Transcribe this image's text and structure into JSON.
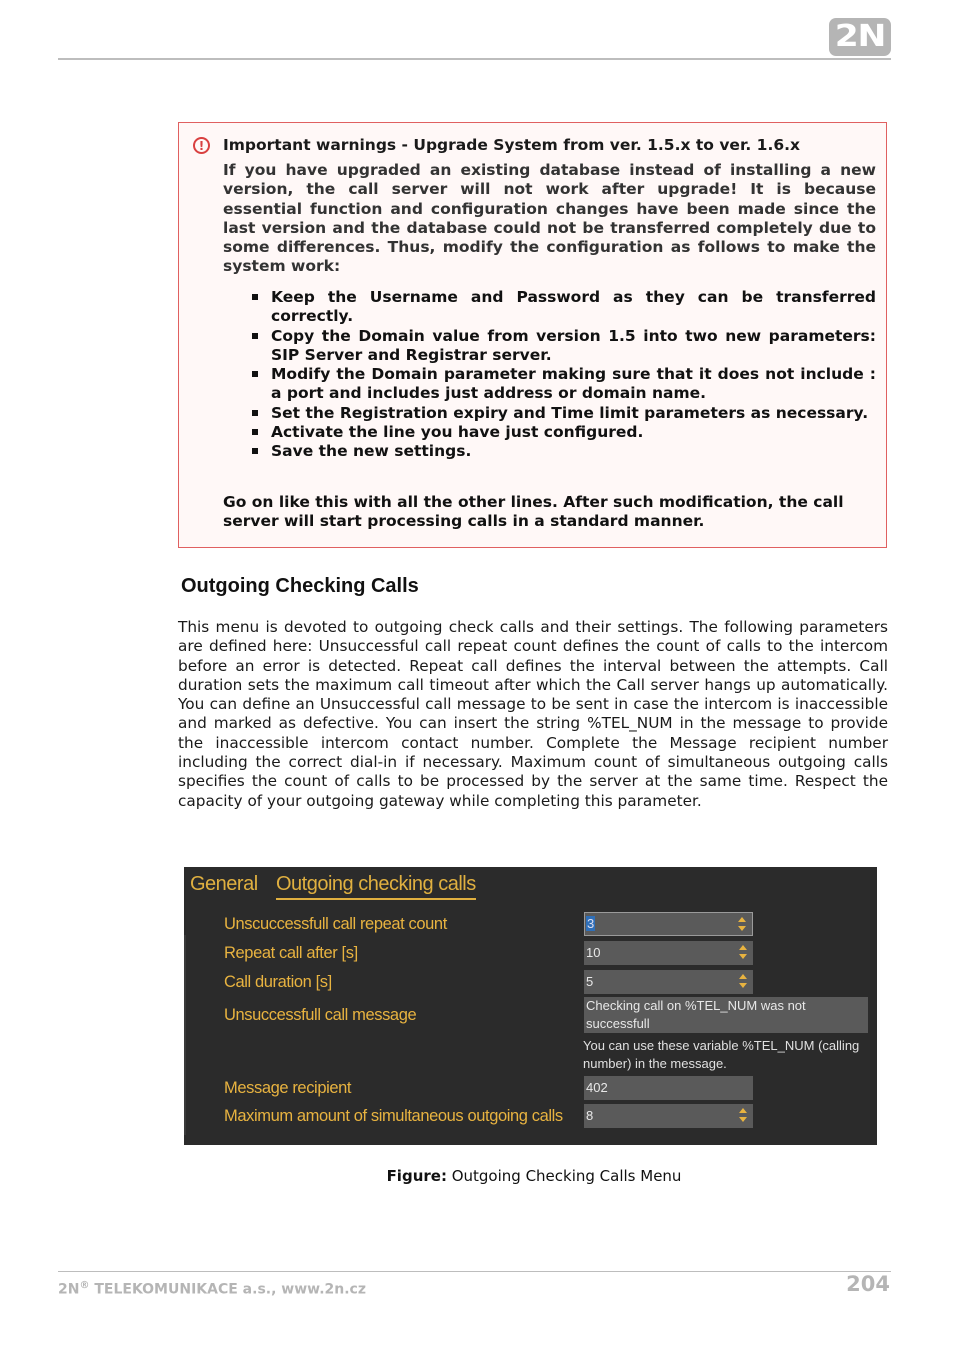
{
  "header": {
    "logo_text": "2N"
  },
  "warning": {
    "icon": "exclamation-circle-icon",
    "title": "Important warnings - Upgrade System from ver. 1.5.x to ver. 1.6.x",
    "intro": "If you have upgraded an existing database instead of installing a new version, the call server will not work after upgrade! It is because essential function and configuration changes have been made since the last version and the database could not be transferred completely due to some differences. Thus, modify the configuration as follows to make the system work:",
    "items": [
      "Keep the Username and Password as they can be transferred correctly.",
      "Copy the Domain value from version 1.5 into two new parameters: SIP Server and Registrar server.",
      "Modify the Domain parameter making sure that it does not include : a port and includes just address or domain name.",
      "Set the Registration expiry and Time limit parameters as necessary.",
      "Activate the line you have just configured.",
      "Save the new settings."
    ],
    "footer": "Go on like this with all the other lines. After such modification, the call server will start processing calls in a standard manner."
  },
  "section": {
    "title": "Outgoing Checking Calls",
    "body": "This menu is devoted to outgoing check calls and their settings. The following parameters are defined here: Unsuccessful call repeat count defines the count of calls to the intercom before an error is detected. Repeat call defines the interval between the attempts. Call duration sets the maximum call timeout after which the Call server hangs up automatically. You can define an Unsuccessful call message to be sent in case the intercom is inaccessible and marked as defective. You can insert the string %TEL_NUM in the message to provide the inaccessible intercom contact number. Complete the Message recipient number including the correct dial-in if necessary. Maximum count of simultaneous outgoing calls specifies the count of calls to be processed by the server at the same time. Respect the capacity of your outgoing gateway while completing this parameter."
  },
  "screenshot": {
    "tabs": [
      {
        "label": "General",
        "active": false
      },
      {
        "label": "Outgoing checking calls",
        "active": true
      }
    ],
    "fields": {
      "repeat_count": {
        "label": "Unscuccessfull call repeat count",
        "value": "3"
      },
      "repeat_after": {
        "label": "Repeat call after [s]",
        "value": "10"
      },
      "call_duration": {
        "label": "Call duration [s]",
        "value": "5"
      },
      "call_message": {
        "label": "Unsuccessfull call message",
        "value": "Checking call on %TEL_NUM was not successfull",
        "hint": "You can use these variable %TEL_NUM (calling number) in the message."
      },
      "message_recipient": {
        "label": "Message recipient",
        "value": "402"
      },
      "max_simultaneous": {
        "label": "Maximum amount of simultaneous outgoing calls",
        "value": "8"
      }
    },
    "colors": {
      "background": "#2b2b2b",
      "accent": "#e8b340",
      "input_background": "#5a5a5a"
    }
  },
  "caption": {
    "prefix": "Figure:",
    "text": " Outgoing Checking Calls Menu"
  },
  "footer": {
    "company_prefix": "2N",
    "registered_mark": "®",
    "company_rest": " TELEKOMUNIKACE a.s., www.2n.cz",
    "page_number": "204"
  }
}
